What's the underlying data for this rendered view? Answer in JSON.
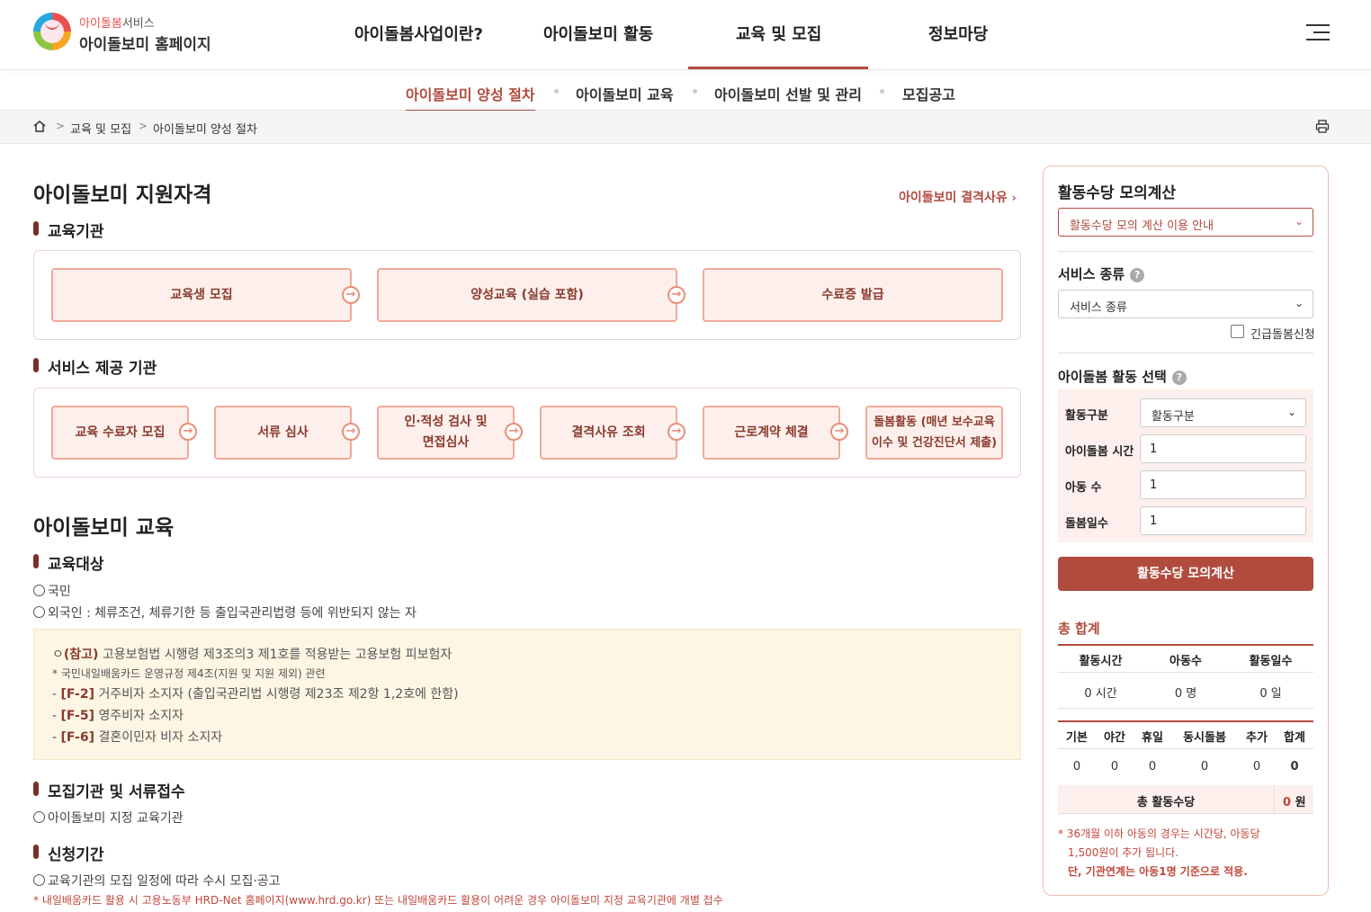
{
  "header": {
    "logo_top_a": "아이돌봄",
    "logo_top_b": "서비스",
    "logo_main": "아이돌보미 홈페이지",
    "nav": [
      "아이돌봄사업이란?",
      "아이돌보미 활동",
      "교육 및 모집",
      "정보마당"
    ]
  },
  "subnav": [
    "아이돌보미 양성 절차",
    "아이돌보미 교육",
    "아이돌보미 선발 및 관리",
    "모집공고"
  ],
  "breadcrumb": [
    "교육 및 모집",
    "아이돌보미 양성 절차"
  ],
  "qual": {
    "title": "아이돌보미 지원자격",
    "link": "아이돌보미 결격사유",
    "edu_heading": "교육기관",
    "edu_steps": [
      "교육생 모집",
      "양성교육 (실습 포함)",
      "수료증 발급"
    ],
    "prov_heading": "서비스 제공 기관",
    "prov_steps": [
      "교육 수료자 모집",
      "서류 심사",
      "인·적성 검사 및\n면접심사",
      "결격사유 조회",
      "근로계약 체결",
      "돌봄활동 (매년 보수교육\n이수 및 건강진단서 제출)"
    ]
  },
  "edu": {
    "title": "아이돌보미 교육",
    "target_heading": "교육대상",
    "target_items": [
      "국민",
      "외국인 : 체류조건, 체류기한 등 출입국관리법령 등에 위반되지 않는 자"
    ],
    "notes": {
      "n1_prefix": "ㅇ",
      "n1_bold": "(참고)",
      "n1_text": " 고용보험법 시행령 제3조의3 제1호를 적용받는 고용보험 피보험자",
      "n2": "* 국민내일배움카드 운영규정 제4조(지원 및 지원 제외) 관련",
      "n3_bold": "[F-2]",
      "n3_text": " 거주비자 소지자 (출입국관리법 시행령 제23조 제2항 1,2호에 한함)",
      "n4_bold": "[F-5]",
      "n4_text": " 영주비자 소지자",
      "n5_bold": "[F-6]",
      "n5_text": " 결혼이민자 비자 소지자",
      "dash": "- "
    },
    "org_heading": "모집기관 및 서류접수",
    "org_item": "아이돌보미 지정 교육기관",
    "period_heading": "신청기간",
    "period_item": "교육기관의 모집 일정에 따라 수시 모집·공고",
    "period_note": "* 내일배움카드 활용 시 고용노동부 HRD-Net 홈페이지(www.hrd.go.kr) 또는 내일배움카드 활용이 어려운 경우 아이돌보미 지정 교육기관에 개별 접수"
  },
  "calc": {
    "title": "활동수당 모의계산",
    "guide_select": "활동수당 모의 계산 이용 안내",
    "service_label": "서비스 종류",
    "service_select": "서비스 종류",
    "emergency": "긴급돌봄신청",
    "activity_label": "아이돌봄 활동 선택",
    "fields": [
      {
        "label": "활동구분",
        "value": "활동구분"
      },
      {
        "label": "아이돌봄 시간",
        "value": "1"
      },
      {
        "label": "아동 수",
        "value": "1"
      },
      {
        "label": "돌봄일수",
        "value": "1"
      }
    ],
    "button": "활동수당 모의계산",
    "total_title": "총 합계",
    "t1_headers": [
      "활동시간",
      "아동수",
      "활동일수"
    ],
    "t1_values": [
      "0 시간",
      "0 명",
      "0 일"
    ],
    "t2_headers": [
      "기본",
      "야간",
      "휴일",
      "동시돌봄",
      "추가",
      "합계"
    ],
    "t2_values": [
      "0",
      "0",
      "0",
      "0",
      "0",
      "0"
    ],
    "total_label": "총 활동수당",
    "total_value": "0",
    "total_unit": "원",
    "note1": "*  36개월 이하 아동의 경우는 시간당, 아동당",
    "note2": "1,500원이 추가 됩니다.",
    "note3": "단, 기관연계는 아동1명 기준으로 적용."
  },
  "colors": {
    "accent": "#b04b3e",
    "step_bg": "#fdf0ec",
    "step_border": "#f1a997",
    "note_bg": "#fdf6e4"
  }
}
